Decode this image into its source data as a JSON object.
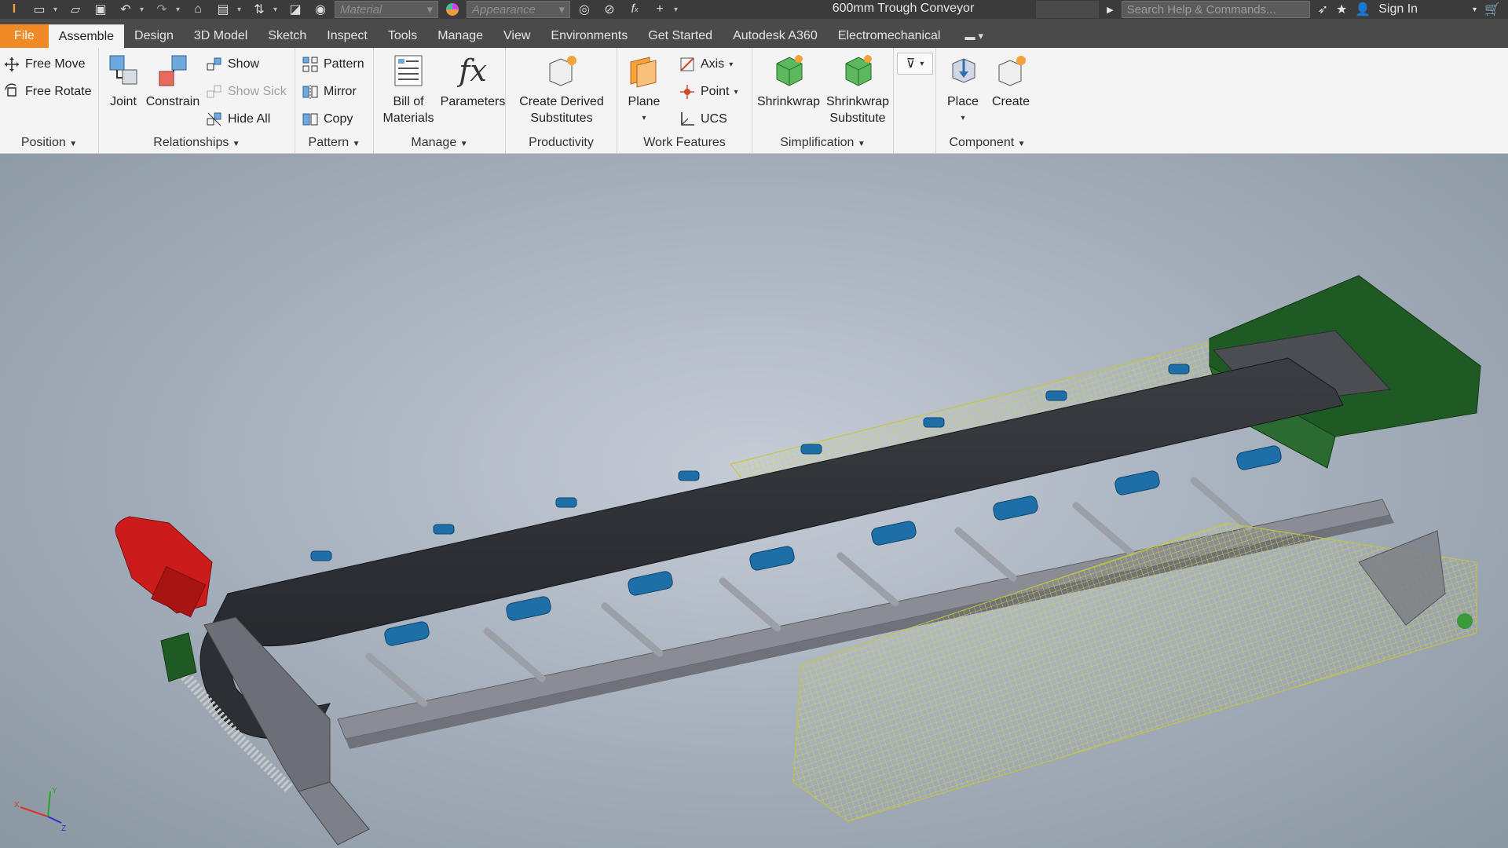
{
  "titlebar": {
    "material_placeholder": "Material",
    "appearance_placeholder": "Appearance",
    "document_title": "600mm Trough Conveyor",
    "search_placeholder": "Search Help & Commands...",
    "sign_in": "Sign In"
  },
  "tabs": [
    "File",
    "Assemble",
    "Design",
    "3D Model",
    "Sketch",
    "Inspect",
    "Tools",
    "Manage",
    "View",
    "Environments",
    "Get Started",
    "Autodesk A360",
    "Electromechanical"
  ],
  "active_tab": "Assemble",
  "ribbon": {
    "position": {
      "free_move": "Free Move",
      "free_rotate": "Free Rotate",
      "title": "Position"
    },
    "relationships": {
      "joint": "Joint",
      "constrain": "Constrain",
      "show": "Show",
      "show_sick": "Show Sick",
      "hide_all": "Hide All",
      "title": "Relationships"
    },
    "pattern": {
      "pattern": "Pattern",
      "mirror": "Mirror",
      "copy": "Copy",
      "title": "Pattern"
    },
    "manage": {
      "bom_line1": "Bill of",
      "bom_line2": "Materials",
      "parameters": "Parameters",
      "title": "Manage"
    },
    "productivity": {
      "line1": "Create Derived",
      "line2": "Substitutes",
      "title": "Productivity"
    },
    "work_features": {
      "plane": "Plane",
      "axis": "Axis",
      "point": "Point",
      "ucs": "UCS",
      "title": "Work Features"
    },
    "simplification": {
      "shrinkwrap": "Shrinkwrap",
      "shrinkwrap_sub_line1": "Shrinkwrap",
      "shrinkwrap_sub_line2": "Substitute",
      "title": "Simplification"
    },
    "component": {
      "place": "Place",
      "create": "Create",
      "title": "Component"
    }
  },
  "triad": {
    "x": "X",
    "y": "Y",
    "z": "Z"
  },
  "colors": {
    "file_tab": "#f08a24",
    "motor": "#cc1b1b",
    "belt": "#2c2f33",
    "idler": "#1e6fa8",
    "frame": "#8a8e94",
    "hopper": "#1f5a25",
    "guard": "#d6d23a"
  }
}
